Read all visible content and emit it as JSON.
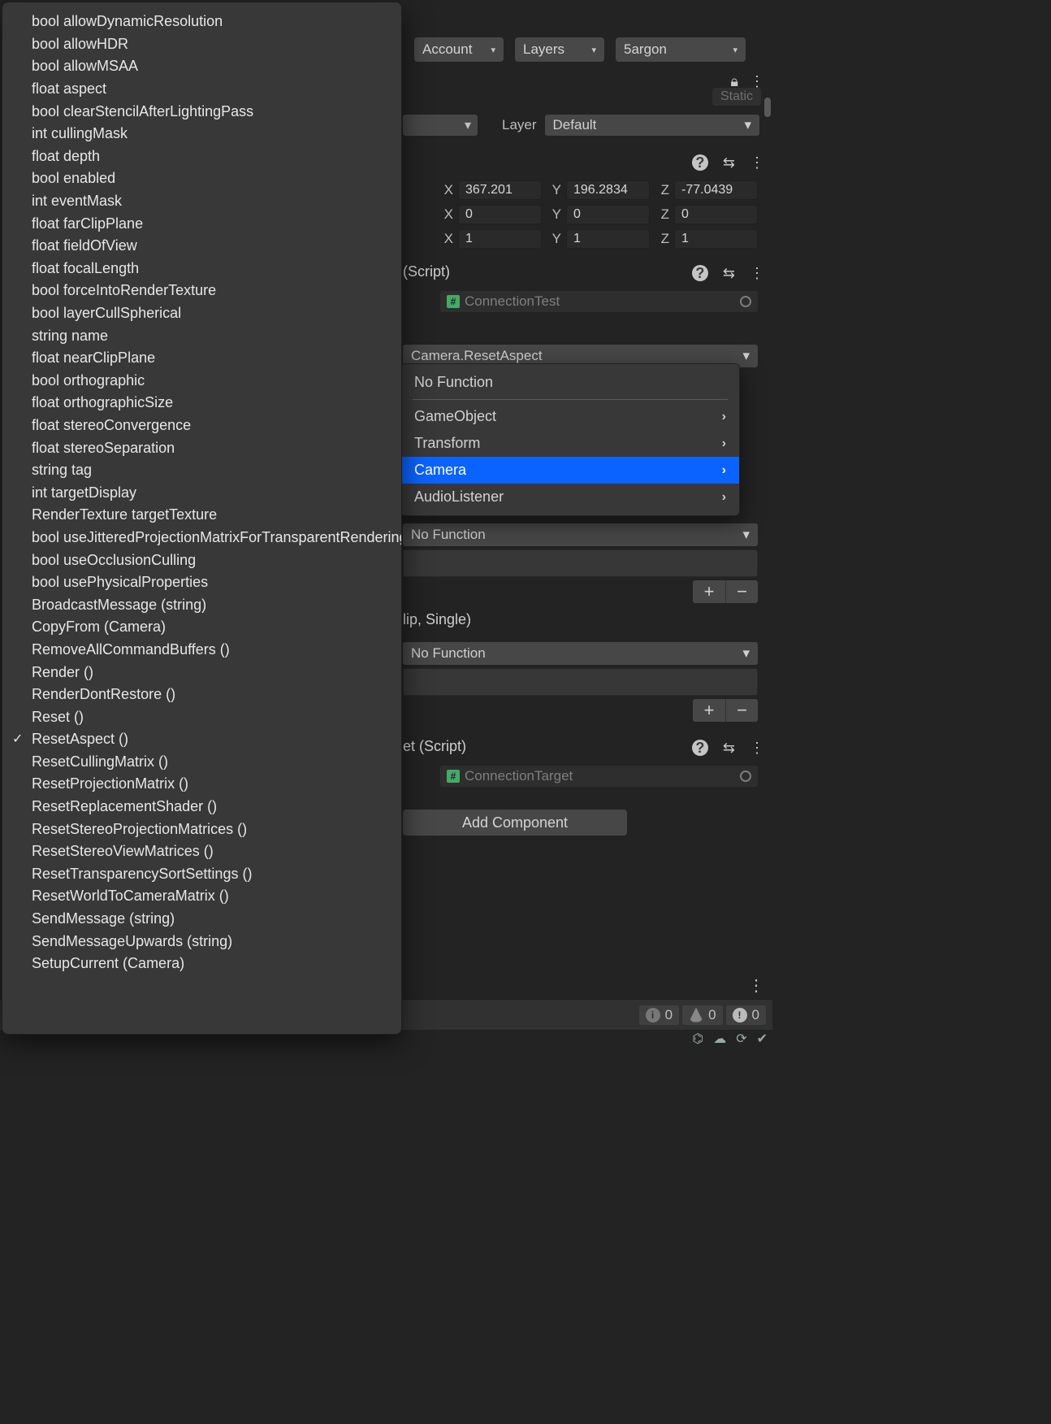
{
  "toolbar": {
    "account": "Account",
    "layers": "Layers",
    "layout": "5argon"
  },
  "inspector": {
    "static_label": "Static",
    "layer_label": "Layer",
    "layer_value": "Default",
    "transform": {
      "position": {
        "x": "367.201",
        "y": "196.2834",
        "z": "-77.0439"
      },
      "rotation": {
        "x": "0",
        "y": "0",
        "z": "0"
      },
      "scale": {
        "x": "1",
        "y": "1",
        "z": "1"
      },
      "axis": {
        "x": "X",
        "y": "Y",
        "z": "Z"
      }
    },
    "comp1": {
      "title": "(Script)",
      "script_name": "ConnectionTest"
    },
    "event_top": {
      "selected": "Camera.ResetAspect"
    },
    "event_nofunc1": "No Function",
    "clip_label": "lip, Single)",
    "event_nofunc2": "No Function",
    "comp2": {
      "title": "et (Script)",
      "script_name": "ConnectionTarget"
    },
    "add_component": "Add Component"
  },
  "ctx_menu": {
    "items": [
      {
        "label": "No Function",
        "sub": false,
        "sel": false,
        "sep_after": true
      },
      {
        "label": "GameObject",
        "sub": true,
        "sel": false
      },
      {
        "label": "Transform",
        "sub": true,
        "sel": false
      },
      {
        "label": "Camera",
        "sub": true,
        "sel": true
      },
      {
        "label": "AudioListener",
        "sub": true,
        "sel": false
      }
    ]
  },
  "camera_members": [
    "bool allowDynamicResolution",
    "bool allowHDR",
    "bool allowMSAA",
    "float aspect",
    "bool clearStencilAfterLightingPass",
    "int cullingMask",
    "float depth",
    "bool enabled",
    "int eventMask",
    "float farClipPlane",
    "float fieldOfView",
    "float focalLength",
    "bool forceIntoRenderTexture",
    "bool layerCullSpherical",
    "string name",
    "float nearClipPlane",
    "bool orthographic",
    "float orthographicSize",
    "float stereoConvergence",
    "float stereoSeparation",
    "string tag",
    "int targetDisplay",
    "RenderTexture targetTexture",
    "bool useJitteredProjectionMatrixForTransparentRendering",
    "bool useOcclusionCulling",
    "bool usePhysicalProperties",
    "BroadcastMessage (string)",
    "CopyFrom (Camera)",
    "RemoveAllCommandBuffers ()",
    "Render ()",
    "RenderDontRestore ()",
    "Reset ()",
    "ResetAspect ()",
    "ResetCullingMatrix ()",
    "ResetProjectionMatrix ()",
    "ResetReplacementShader ()",
    "ResetStereoProjectionMatrices ()",
    "ResetStereoViewMatrices ()",
    "ResetTransparencySortSettings ()",
    "ResetWorldToCameraMatrix ()",
    "SendMessage (string)",
    "SendMessageUpwards (string)",
    "SetupCurrent (Camera)"
  ],
  "camera_member_checked": "ResetAspect ()",
  "console": {
    "info": "0",
    "warn": "0",
    "err": "0"
  }
}
